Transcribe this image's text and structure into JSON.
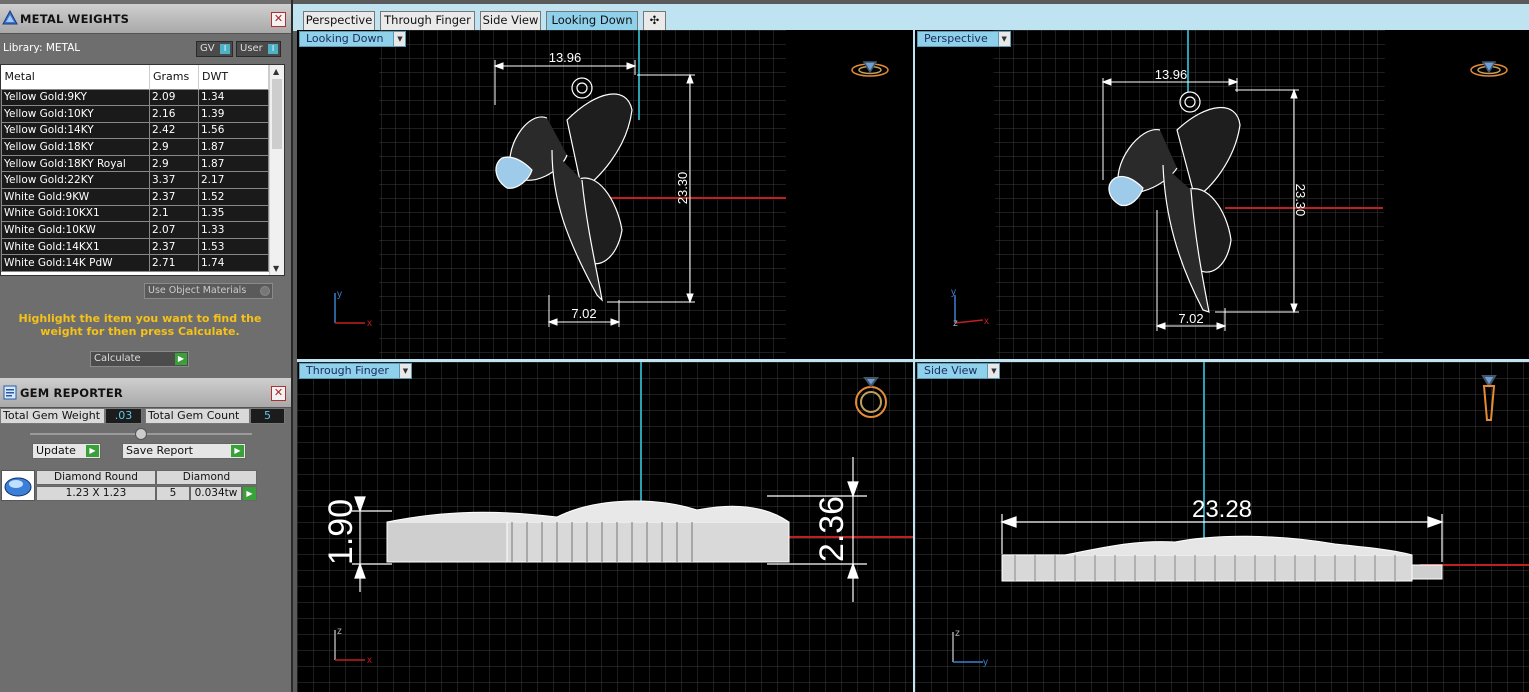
{
  "metal_weights": {
    "title": "METAL WEIGHTS",
    "library_label": "Library: METAL",
    "toggle_gv": "GV",
    "toggle_user": "User",
    "columns": [
      "Metal",
      "Grams",
      "DWT"
    ],
    "rows": [
      {
        "metal": "Yellow Gold:9KY",
        "grams": "2.09",
        "dwt": "1.34"
      },
      {
        "metal": "Yellow Gold:10KY",
        "grams": "2.16",
        "dwt": "1.39"
      },
      {
        "metal": "Yellow Gold:14KY",
        "grams": "2.42",
        "dwt": "1.56"
      },
      {
        "metal": "Yellow Gold:18KY",
        "grams": "2.9",
        "dwt": "1.87"
      },
      {
        "metal": "Yellow Gold:18KY Royal",
        "grams": "2.9",
        "dwt": "1.87"
      },
      {
        "metal": "Yellow Gold:22KY",
        "grams": "3.37",
        "dwt": "2.17"
      },
      {
        "metal": "White Gold:9KW",
        "grams": "2.37",
        "dwt": "1.52"
      },
      {
        "metal": "White Gold:10KX1",
        "grams": "2.1",
        "dwt": "1.35"
      },
      {
        "metal": "White Gold:10KW",
        "grams": "2.07",
        "dwt": "1.33"
      },
      {
        "metal": "White Gold:14KX1",
        "grams": "2.37",
        "dwt": "1.53"
      },
      {
        "metal": "White Gold:14K PdW",
        "grams": "2.71",
        "dwt": "1.74"
      }
    ],
    "use_object_materials": "Use Object Materials",
    "hint": "Highlight the item you want to find the weight for then press Calculate.",
    "calculate_label": "Calculate"
  },
  "gem_reporter": {
    "title": "GEM REPORTER",
    "total_weight_label": "Total Gem Weight",
    "total_weight_value": ".03",
    "total_count_label": "Total Gem Count",
    "total_count_value": "5",
    "update_label": "Update",
    "save_report_label": "Save Report",
    "gem": {
      "shape": "Diamond Round",
      "type": "Diamond",
      "size": "1.23 X 1.23",
      "count": "5",
      "weight": "0.034tw"
    }
  },
  "tabs": [
    {
      "label": "Perspective",
      "active": false
    },
    {
      "label": "Through Finger",
      "active": false
    },
    {
      "label": "Side View",
      "active": false
    },
    {
      "label": "Looking Down",
      "active": true
    }
  ],
  "add_tab_symbol": "✣",
  "viewports": {
    "top_left": {
      "label": "Looking Down",
      "dim_width": "13.96",
      "dim_height": "23.30",
      "dim_base": "7.02",
      "axis_y": "y",
      "axis_x": "x"
    },
    "top_right": {
      "label": "Perspective",
      "dim_width": "13.96",
      "dim_height": "23.30",
      "dim_base": "7.02",
      "axis_y": "y",
      "axis_z": "z",
      "axis_x": "x"
    },
    "bottom_left": {
      "label": "Through Finger",
      "dim_left": "1.90",
      "dim_right": "2.36",
      "axis_z": "z",
      "axis_x": "x"
    },
    "bottom_right": {
      "label": "Side View",
      "dim_length": "23.28",
      "axis_z": "z",
      "axis_y": "y"
    }
  },
  "colors": {
    "tab_bar": "#bfe3f0",
    "viewport_label": "#8fd0ea",
    "grid": "#3c3c3c",
    "axis_red": "#c02020",
    "axis_cyan": "#2aa0b0",
    "hint_yellow": "#f5c218"
  }
}
